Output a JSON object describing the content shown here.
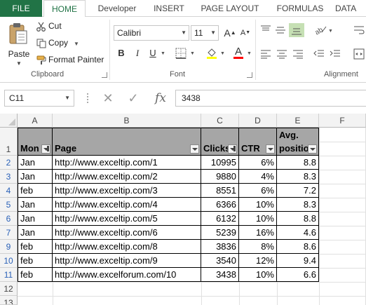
{
  "ribbon_tabs": [
    "FILE",
    "HOME",
    "Developer",
    "INSERT",
    "PAGE LAYOUT",
    "FORMULAS",
    "DATA"
  ],
  "clipboard": {
    "paste": "Paste",
    "cut": "Cut",
    "copy": "Copy",
    "format_painter": "Format Painter",
    "group_label": "Clipboard"
  },
  "font": {
    "name": "Calibri",
    "size": "11",
    "bold": "B",
    "italic": "I",
    "underline": "U",
    "group_label": "Font",
    "highlight_color": "#ffff00",
    "font_color": "#ff0000"
  },
  "alignment": {
    "group_label": "Alignment"
  },
  "formula_bar": {
    "name_box": "C11",
    "fx": "fx",
    "value": "3438"
  },
  "columns": [
    "A",
    "B",
    "C",
    "D",
    "E",
    "F"
  ],
  "rows": [
    "1",
    "2",
    "3",
    "4",
    "5",
    "6",
    "7",
    "9",
    "10",
    "11",
    "12",
    "13"
  ],
  "table": {
    "headers": [
      {
        "label": "Mon",
        "filter": "active"
      },
      {
        "label": "Page",
        "filter": "plain"
      },
      {
        "label": "Clicks",
        "filter": "active"
      },
      {
        "label": "CTR",
        "filter": "plain"
      },
      {
        "label_line1": "Avg.",
        "label_line2": "positio",
        "filter": "plain"
      }
    ],
    "data": [
      [
        "Jan",
        "http://www.exceltip.com/1",
        "10995",
        "6%",
        "8.8"
      ],
      [
        "Jan",
        "http://www.exceltip.com/2",
        "9880",
        "4%",
        "8.3"
      ],
      [
        "feb",
        "http://www.exceltip.com/3",
        "8551",
        "6%",
        "7.2"
      ],
      [
        "Jan",
        "http://www.exceltip.com/4",
        "6366",
        "10%",
        "8.3"
      ],
      [
        "Jan",
        "http://www.exceltip.com/5",
        "6132",
        "10%",
        "8.8"
      ],
      [
        "Jan",
        "http://www.exceltip.com/6",
        "5239",
        "16%",
        "4.6"
      ],
      [
        "feb",
        "http://www.exceltip.com/8",
        "3836",
        "8%",
        "8.6"
      ],
      [
        "feb",
        "http://www.exceltip.com/9",
        "3540",
        "12%",
        "9.4"
      ],
      [
        "feb",
        "http://www.excelforum.com/10",
        "3438",
        "10%",
        "6.6"
      ]
    ]
  },
  "colors": {
    "file_tab": "#217346",
    "header_fill": "#a6a6a6",
    "row_number_filtered": "#2a61b8"
  }
}
